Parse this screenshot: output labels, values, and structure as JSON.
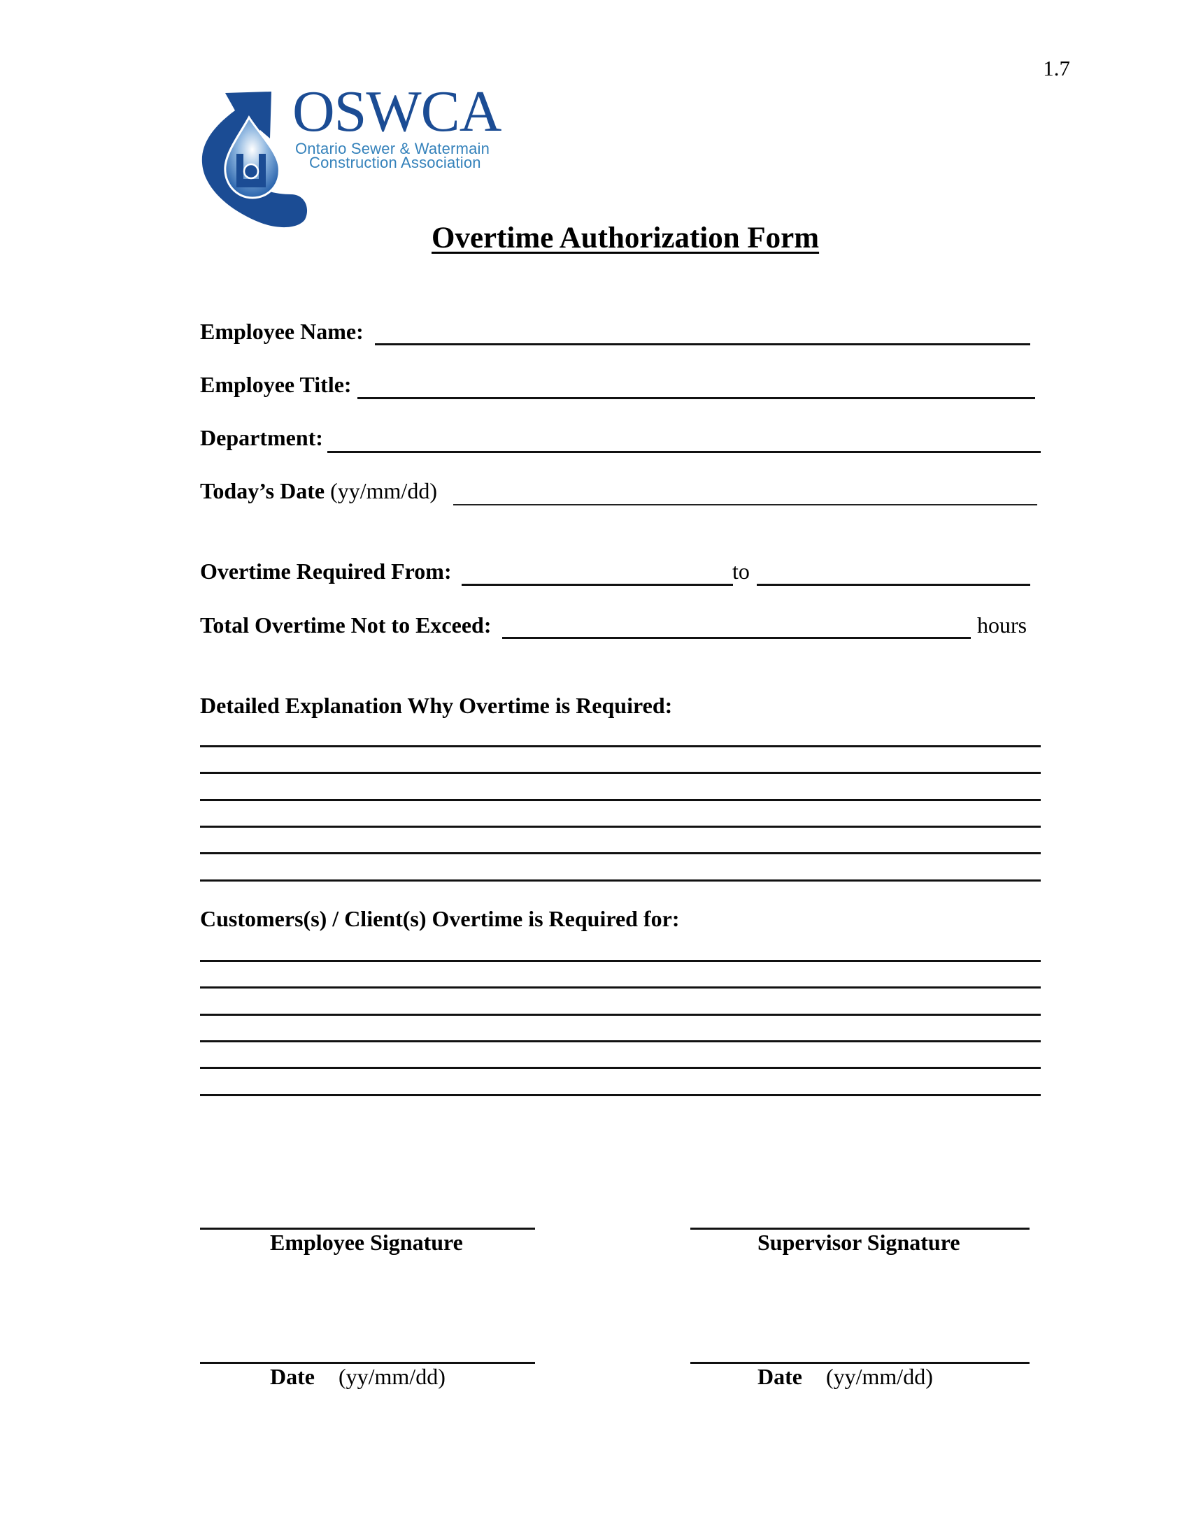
{
  "page_number": "1.7",
  "logo": {
    "wordmark": "OSWCA",
    "subtitle_line1": "Ontario Sewer & Watermain",
    "subtitle_line2": "Construction Association",
    "colors": {
      "primary": "#1b4c94",
      "secondary": "#3582bb"
    }
  },
  "title": "Overtime Authorization Form",
  "fields": {
    "employee_name": {
      "label": "Employee Name:",
      "value": ""
    },
    "employee_title": {
      "label": "Employee Title:",
      "value": ""
    },
    "department": {
      "label": "Department:",
      "value": ""
    },
    "todays_date": {
      "label": "Today’s Date",
      "hint": "(yy/mm/dd)",
      "value": ""
    },
    "overtime_from": {
      "label": "Overtime Required From:",
      "value": ""
    },
    "overtime_to": {
      "label": "to",
      "value": ""
    },
    "overtime_limit": {
      "label": "Total Overtime Not to Exceed:",
      "unit": "hours",
      "value": ""
    }
  },
  "explanation": {
    "heading": "Detailed Explanation Why Overtime is Required:",
    "lines": [
      "",
      "",
      "",
      "",
      "",
      ""
    ]
  },
  "customers": {
    "heading": "Customers(s) / Client(s) Overtime is Required for:",
    "lines": [
      "",
      "",
      "",
      "",
      "",
      ""
    ]
  },
  "signatures": {
    "employee": {
      "label": "Employee Signature",
      "date_label": "Date",
      "date_hint": "(yy/mm/dd)"
    },
    "supervisor": {
      "label": "Supervisor Signature",
      "date_label": "Date",
      "date_hint": "(yy/mm/dd)"
    }
  }
}
